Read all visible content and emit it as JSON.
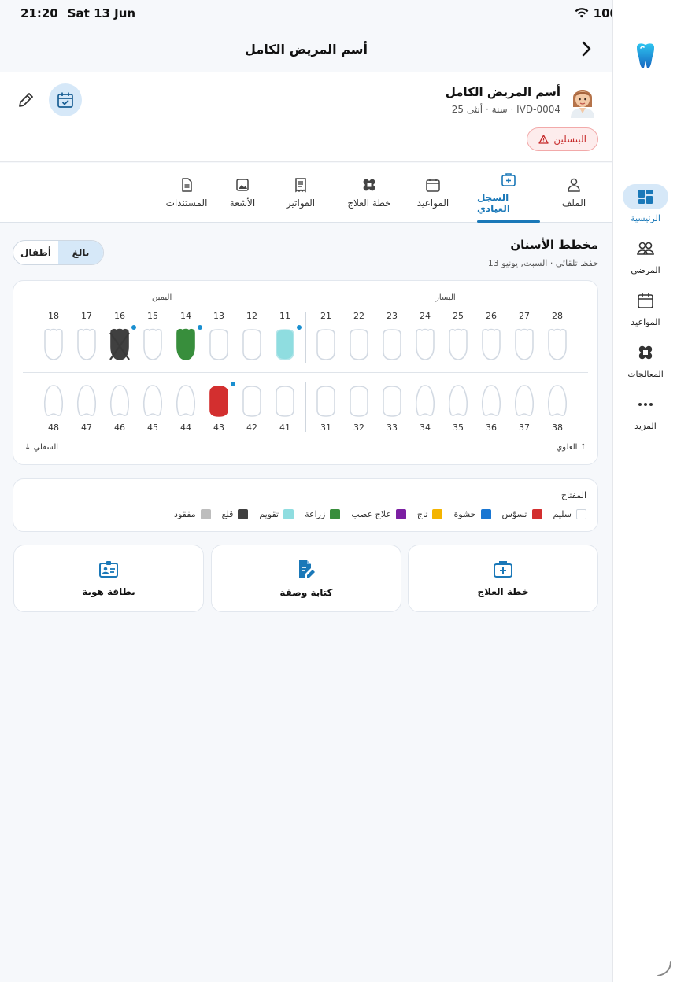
{
  "status": {
    "time": "21:20",
    "date": "Sat 13 Jun",
    "battery": "100%"
  },
  "header": {
    "title": "أسم المريض الكامل"
  },
  "patient": {
    "name": "أسم المريض الكامل",
    "meta": "25 سنة · أنثى · IVD-0004",
    "allergy": "البنسلين"
  },
  "tabs": [
    {
      "label": "الملف",
      "icon": "person-icon"
    },
    {
      "label": "السجل العيادي",
      "icon": "medical-bag-icon",
      "active": true
    },
    {
      "label": "المواعيد",
      "icon": "calendar-icon"
    },
    {
      "label": "خطة العلاج",
      "icon": "bandage-icon"
    },
    {
      "label": "الفواتير",
      "icon": "receipt-icon"
    },
    {
      "label": "الأشعة",
      "icon": "image-icon"
    },
    {
      "label": "المستندات",
      "icon": "document-icon"
    }
  ],
  "chart": {
    "title": "مخطط الأسنان",
    "subtitle": "حفظ تلقائي · السبت, يونيو 13",
    "toggle": {
      "adult": "بالغ",
      "child": "أطفال",
      "selected": "adult"
    },
    "right_label": "اليمين",
    "left_label": "اليسار",
    "upper_label": "العلوي",
    "lower_label": "السفلي",
    "upper_right": [
      {
        "num": "18",
        "status": "healthy"
      },
      {
        "num": "17",
        "status": "healthy"
      },
      {
        "num": "16",
        "status": "extraction",
        "note": true
      },
      {
        "num": "15",
        "status": "healthy"
      },
      {
        "num": "14",
        "status": "root_canal_implant",
        "note": true
      },
      {
        "num": "13",
        "status": "healthy"
      },
      {
        "num": "12",
        "status": "healthy"
      },
      {
        "num": "11",
        "status": "orthodontic",
        "note": true
      }
    ],
    "upper_left": [
      {
        "num": "21",
        "status": "healthy"
      },
      {
        "num": "22",
        "status": "healthy"
      },
      {
        "num": "23",
        "status": "healthy"
      },
      {
        "num": "24",
        "status": "healthy"
      },
      {
        "num": "25",
        "status": "healthy"
      },
      {
        "num": "26",
        "status": "healthy"
      },
      {
        "num": "27",
        "status": "healthy"
      },
      {
        "num": "28",
        "status": "healthy"
      }
    ],
    "lower_right": [
      {
        "num": "48",
        "status": "healthy"
      },
      {
        "num": "47",
        "status": "healthy"
      },
      {
        "num": "46",
        "status": "healthy"
      },
      {
        "num": "45",
        "status": "healthy"
      },
      {
        "num": "44",
        "status": "healthy"
      },
      {
        "num": "43",
        "status": "caries",
        "note": true
      },
      {
        "num": "42",
        "status": "healthy"
      },
      {
        "num": "41",
        "status": "healthy"
      }
    ],
    "lower_left": [
      {
        "num": "31",
        "status": "healthy"
      },
      {
        "num": "32",
        "status": "healthy"
      },
      {
        "num": "33",
        "status": "healthy"
      },
      {
        "num": "34",
        "status": "healthy"
      },
      {
        "num": "35",
        "status": "healthy"
      },
      {
        "num": "36",
        "status": "healthy"
      },
      {
        "num": "37",
        "status": "healthy"
      },
      {
        "num": "38",
        "status": "healthy"
      }
    ]
  },
  "legend": {
    "title": "المفتاح",
    "items": [
      {
        "label": "سليم",
        "color": "#ffffff"
      },
      {
        "label": "تسوّس",
        "color": "#d32f2f"
      },
      {
        "label": "حشوة",
        "color": "#1976d2"
      },
      {
        "label": "تاج",
        "color": "#f4b400"
      },
      {
        "label": "علاج عصب",
        "color": "#7b1fa2"
      },
      {
        "label": "زراعة",
        "color": "#388e3c"
      },
      {
        "label": "تقويم",
        "color": "#8fdde0"
      },
      {
        "label": "قلع",
        "color": "#404040"
      },
      {
        "label": "مفقود",
        "color": "#bdbdbd"
      }
    ]
  },
  "actions": [
    {
      "label": "خطة العلاج",
      "icon": "medical-bag-icon"
    },
    {
      "label": "كتابة وصفة",
      "icon": "edit-document-icon"
    },
    {
      "label": "بطاقة هوية",
      "icon": "id-card-icon"
    }
  ],
  "rail": {
    "items": [
      {
        "label": "الرئيسية",
        "icon": "dashboard-icon",
        "active": true
      },
      {
        "label": "المرضى",
        "icon": "people-icon"
      },
      {
        "label": "المواعيد",
        "icon": "calendar-icon"
      },
      {
        "label": "المعالجات",
        "icon": "bandage-icon"
      },
      {
        "label": "المزيد",
        "icon": "more-icon"
      }
    ]
  },
  "colors": {
    "accent": "#1a78b8",
    "caries": "#d32f2f",
    "implant": "#388e3c",
    "orthodontic": "#8fdde0",
    "extraction": "#404040",
    "note_dot": "#1a8fd0"
  }
}
